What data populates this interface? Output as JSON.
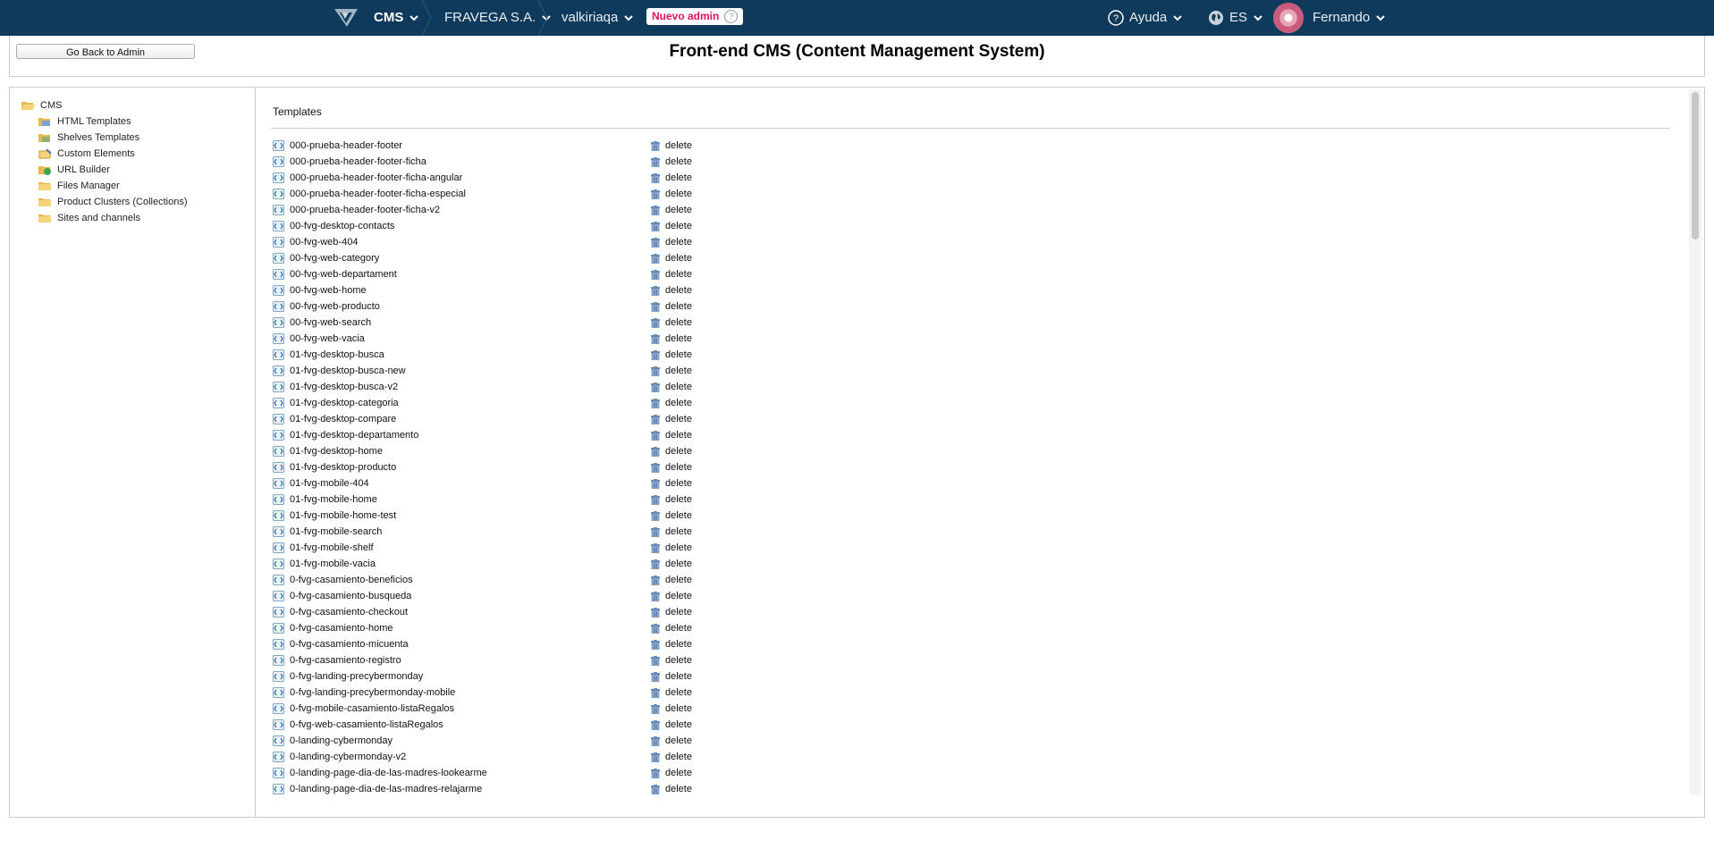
{
  "topbar": {
    "logo_icon": "vtex-logo-icon",
    "app_label": "CMS",
    "company_label": "FRAVEGA S.A.",
    "account_label": "valkiriaqa",
    "badge_label": "Nuevo admin",
    "help_label": "Ayuda",
    "lang_label": "ES",
    "user_label": "Fernando",
    "bg_color": "#0f3a5c"
  },
  "header": {
    "back_button": "Go Back to Admin",
    "title": "Front-end CMS (Content Management System)"
  },
  "sidebar": {
    "root": "CMS",
    "items": [
      {
        "label": "HTML Templates",
        "icon": "templates-folder-icon"
      },
      {
        "label": "Shelves Templates",
        "icon": "shelves-folder-icon"
      },
      {
        "label": "Custom Elements",
        "icon": "custom-elements-icon"
      },
      {
        "label": "URL Builder",
        "icon": "url-builder-icon"
      },
      {
        "label": "Files Manager",
        "icon": "folder-icon"
      },
      {
        "label": "Product Clusters (Collections)",
        "icon": "folder-icon"
      },
      {
        "label": "Sites and channels",
        "icon": "folder-icon"
      }
    ]
  },
  "main": {
    "section_title": "Templates",
    "delete_label": "delete",
    "templates": [
      "000-prueba-header-footer",
      "000-prueba-header-footer-ficha",
      "000-prueba-header-footer-ficha-angular",
      "000-prueba-header-footer-ficha-especial",
      "000-prueba-header-footer-ficha-v2",
      "00-fvg-desktop-contacts",
      "00-fvg-web-404",
      "00-fvg-web-category",
      "00-fvg-web-departament",
      "00-fvg-web-home",
      "00-fvg-web-producto",
      "00-fvg-web-search",
      "00-fvg-web-vacia",
      "01-fvg-desktop-busca",
      "01-fvg-desktop-busca-new",
      "01-fvg-desktop-busca-v2",
      "01-fvg-desktop-categoria",
      "01-fvg-desktop-compare",
      "01-fvg-desktop-departamento",
      "01-fvg-desktop-home",
      "01-fvg-desktop-producto",
      "01-fvg-mobile-404",
      "01-fvg-mobile-home",
      "01-fvg-mobile-home-test",
      "01-fvg-mobile-search",
      "01-fvg-mobile-shelf",
      "01-fvg-mobile-vacia",
      "0-fvg-casamiento-beneficios",
      "0-fvg-casamiento-busqueda",
      "0-fvg-casamiento-checkout",
      "0-fvg-casamiento-home",
      "0-fvg-casamiento-micuenta",
      "0-fvg-casamiento-registro",
      "0-fvg-landing-precybermonday",
      "0-fvg-landing-precybermonday-mobile",
      "0-fvg-mobile-casamiento-listaRegalos",
      "0-fvg-web-casamiento-listaRegalos",
      "0-landing-cybermonday",
      "0-landing-cybermonday-v2",
      "0-landing-page-dia-de-las-madres-lookearme",
      "0-landing-page-dia-de-las-madres-relajarme"
    ]
  }
}
